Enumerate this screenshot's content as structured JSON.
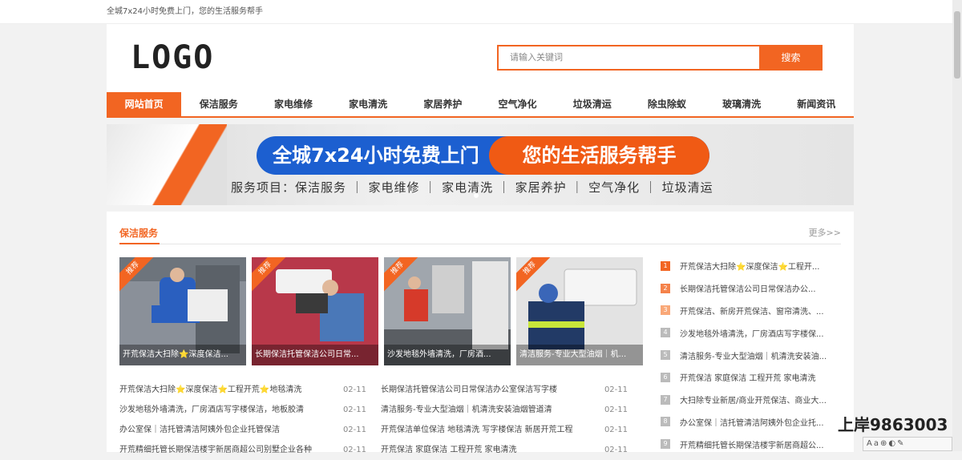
{
  "topbar": {
    "text": "全城7x24小时免费上门，您的生活服务帮手"
  },
  "header": {
    "logo": "LOGO",
    "search_placeholder": "请输入关键词",
    "search_button": "搜索"
  },
  "nav": [
    "网站首页",
    "保洁服务",
    "家电维修",
    "家电清洗",
    "家居养护",
    "空气净化",
    "垃圾清运",
    "除虫除蚁",
    "玻璃清洗",
    "新闻资讯"
  ],
  "banner": {
    "headline_left": "全城7x24小时免费上门",
    "headline_right": "您的生活服务帮手",
    "services": "服务项目：保洁服务 ｜ 家电维修 ｜ 家电清洗 ｜ 家居养护 ｜ 空气净化 ｜ 垃圾清运"
  },
  "section": {
    "title": "保洁服务",
    "more": "更多>>",
    "cards": [
      {
        "tag": "推荐",
        "caption": "开荒保洁大扫除⭐深度保洁..."
      },
      {
        "tag": "推荐",
        "caption": "长期保洁托管保洁公司日常..."
      },
      {
        "tag": "推荐",
        "caption": "沙发地毯外墙清洗，厂房酒..."
      },
      {
        "tag": "推荐",
        "caption": "清洁服务-专业大型油烟｜机..."
      }
    ],
    "news": [
      [
        {
          "title": "开荒保洁大扫除⭐深度保洁⭐工程开荒⭐地毯清洗",
          "date": "02-11"
        },
        {
          "title": "长期保洁托管保洁公司日常保洁办公室保洁写字楼",
          "date": "02-11"
        }
      ],
      [
        {
          "title": "沙发地毯外墙清洗，厂房酒店写字楼保洁，地板胶清",
          "date": "02-11"
        },
        {
          "title": "清洁服务-专业大型油烟｜机清洗安装油烟管道清",
          "date": "02-11"
        }
      ],
      [
        {
          "title": "办公室保｜洁托管清洁阿姨外包企业托管保洁",
          "date": "02-11"
        },
        {
          "title": "开荒保洁单位保洁 地毯清洗 写字楼保洁 新居开荒工程",
          "date": "02-11"
        }
      ],
      [
        {
          "title": "开荒精细托管长期保洁楼宇新居商超公司别墅企业各种",
          "date": "02-11"
        },
        {
          "title": "开荒保洁 家庭保洁 工程开荒 家电清洗",
          "date": "02-11"
        }
      ]
    ],
    "rank": [
      "开荒保洁大扫除⭐深度保洁⭐工程开...",
      "长期保洁托管保洁公司日常保洁办公...",
      "开荒保洁、新房开荒保洁、窗帘清洗、...",
      "沙发地毯外墙清洗，厂房酒店写字楼保...",
      "清洁服务-专业大型油烟｜机清洗安装油...",
      "开荒保洁 家庭保洁 工程开荒 家电清洗",
      "大扫除专业新居/商业开荒保洁、商业大...",
      "办公室保｜洁托管清洁阿姨外包企业托...",
      "开荒精细托管长期保洁楼宇新居商超公..."
    ]
  },
  "overlay": {
    "watermark": "上岸9863003",
    "tray": "Aa⊕◐✎"
  }
}
